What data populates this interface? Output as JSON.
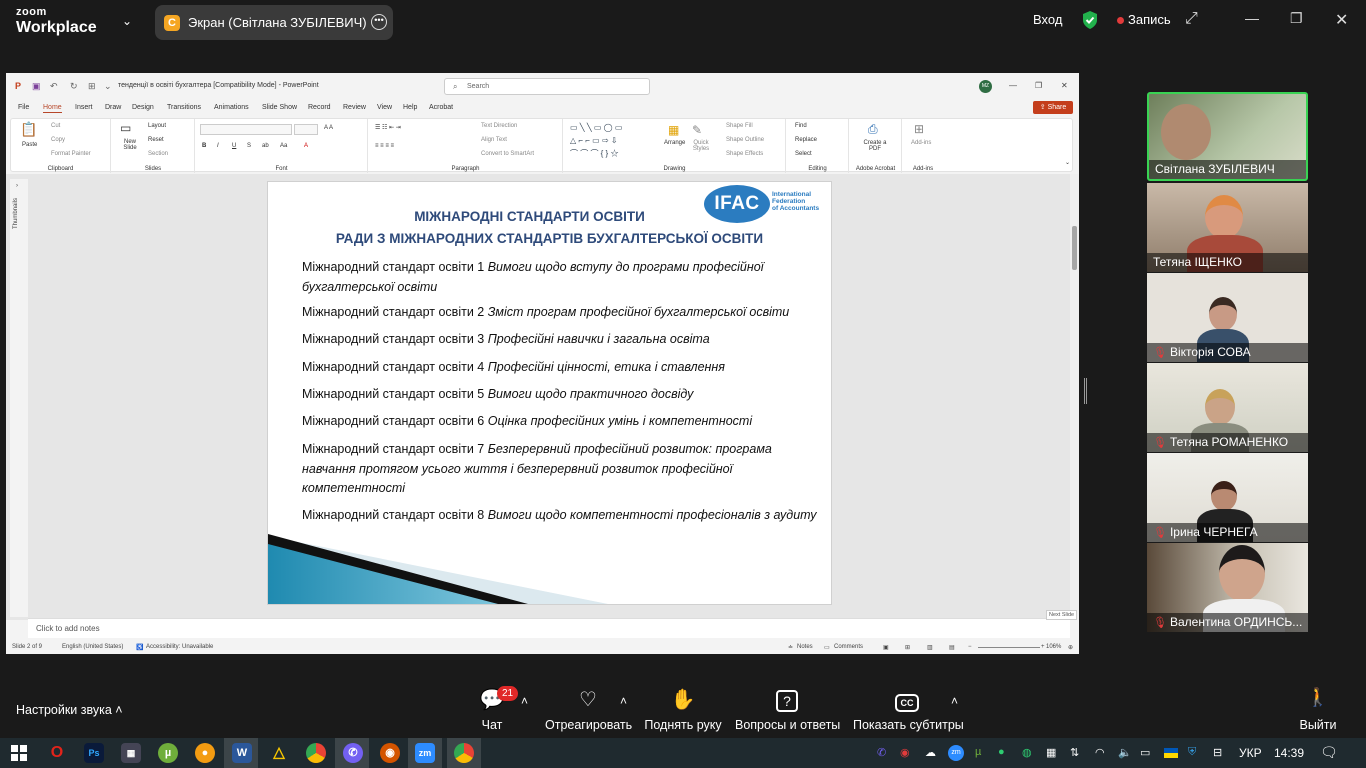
{
  "zoom": {
    "logo_line1": "zoom",
    "logo_line2": "Workplace",
    "share_initial": "С",
    "share_title": "Экран (Світлана ЗУБІЛЕВИЧ)",
    "login": "Вход",
    "recording": "Запись"
  },
  "ppt": {
    "title": "тенденції в освіті бухгалтера [Compatibility Mode]  -  PowerPoint",
    "search_placeholder": "Search",
    "user_initials": "MZ",
    "share": "Share",
    "menu": [
      "File",
      "Home",
      "Insert",
      "Draw",
      "Design",
      "Transitions",
      "Animations",
      "Slide Show",
      "Record",
      "Review",
      "View",
      "Help",
      "Acrobat"
    ],
    "ribbon": {
      "clipboard": {
        "label": "Clipboard",
        "paste": "Paste",
        "cut": "Cut",
        "copy": "Copy",
        "format_painter": "Format Painter"
      },
      "slides": {
        "label": "Slides",
        "new_slide": "New Slide",
        "layout": "Layout",
        "reset": "Reset",
        "section": "Section"
      },
      "font": {
        "label": "Font"
      },
      "paragraph": {
        "label": "Paragraph",
        "text_direction": "Text Direction",
        "align_text": "Align Text",
        "convert": "Convert to SmartArt"
      },
      "drawing": {
        "label": "Drawing",
        "arrange": "Arrange",
        "quick_styles": "Quick Styles",
        "shape_fill": "Shape Fill",
        "shape_outline": "Shape Outline",
        "shape_effects": "Shape Effects"
      },
      "editing": {
        "label": "Editing",
        "find": "Find",
        "replace": "Replace",
        "select": "Select"
      },
      "acrobat": {
        "label": "Adobe Acrobat",
        "create_pdf": "Create a PDF"
      },
      "addins": {
        "label": "Add-ins",
        "addins": "Add-ins"
      }
    },
    "thumbnails_label": "Thumbnails",
    "notes_placeholder": "Click to add notes",
    "next_slide_tip": "Next Slide",
    "status": {
      "slide": "Slide 2 of 9",
      "language": "English (United States)",
      "accessibility": "Accessibility: Unavailable",
      "notes": "Notes",
      "comments": "Comments",
      "zoom": "106%"
    }
  },
  "slide": {
    "title1": "МІЖНАРОДНІ СТАНДАРТИ ОСВІТИ",
    "title2": "РАДИ З МІЖНАРОДНИХ СТАНДАРТІВ БУХГАЛТЕРСЬКОЇ ОСВІТИ",
    "logo": "IFAC",
    "logo_text1": "International",
    "logo_text2": "Federation",
    "logo_text3": "of Accountants",
    "standards": [
      {
        "prefix": "Міжнародний стандарт освіти 1 ",
        "title": "Вимоги щодо вступу до програми професійної бухгалтерської освіти"
      },
      {
        "prefix": "Міжнародний стандарт освіти 2 ",
        "title": "Зміст програм професійної бухгалтерської освіти"
      },
      {
        "prefix": "Міжнародний стандарт освіти 3 ",
        "title": "Професійні навички і загальна освіта"
      },
      {
        "prefix": "Міжнародний стандарт освіти 4 ",
        "title": "Професійні цінності, етика і ставлення"
      },
      {
        "prefix": "Міжнародний стандарт освіти 5 ",
        "title": "Вимоги щодо практичного досвіду"
      },
      {
        "prefix": "Міжнародний стандарт освіти 6 ",
        "title": "Оцінка професійних умінь і компетентності"
      },
      {
        "prefix": "Міжнародний стандарт освіти 7 ",
        "title": "Безперервний професійний розвиток: програма навчання протягом усього життя і безперервний розвиток професійної компетентності"
      },
      {
        "prefix": "Міжнародний стандарт освіти 8 ",
        "title": "Вимоги щодо компетентності професіоналів з аудиту"
      }
    ]
  },
  "participants": [
    {
      "name": "Світлана ЗУБІЛЕВИЧ",
      "muted": false
    },
    {
      "name": "Тетяна ІЩЕНКО",
      "muted": false
    },
    {
      "name": "Вікторія СОВА",
      "muted": true
    },
    {
      "name": "Тетяна РОМАНЕНКО",
      "muted": true
    },
    {
      "name": "Ірина ЧЕРНЕГА",
      "muted": true
    },
    {
      "name": "Валентина ОРДИНСЬ...",
      "muted": true
    }
  ],
  "toolbar": {
    "sound_settings": "Настройки звука",
    "chat": "Чат",
    "chat_badge": "21",
    "react": "Отреагировать",
    "raise_hand": "Поднять руку",
    "qa": "Вопросы и ответы",
    "captions": "Показать субтитры",
    "captions_icon": "CC",
    "exit": "Выйти"
  },
  "taskbar": {
    "lang": "УКР",
    "time": "14:39"
  }
}
